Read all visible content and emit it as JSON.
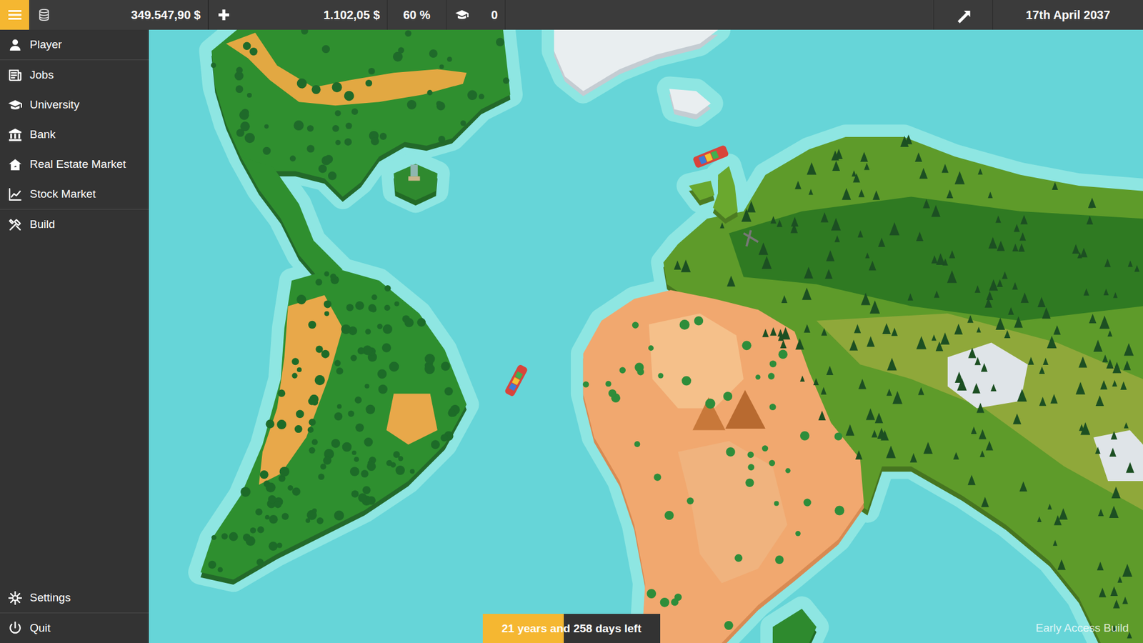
{
  "topbar": {
    "money": "349.547,90 $",
    "income": "1.102,05 $",
    "percent": "60 %",
    "education": "0",
    "date": "17th April 2037"
  },
  "sidebar": {
    "groups": [
      {
        "items": [
          {
            "label": "Player"
          }
        ]
      },
      {
        "items": [
          {
            "label": "Jobs"
          },
          {
            "label": "University"
          },
          {
            "label": "Bank"
          },
          {
            "label": "Real Estate Market"
          },
          {
            "label": "Stock Market"
          }
        ]
      },
      {
        "items": [
          {
            "label": "Build"
          }
        ]
      }
    ],
    "bottom_groups": [
      {
        "items": [
          {
            "label": "Settings"
          }
        ]
      },
      {
        "items": [
          {
            "label": "Quit"
          }
        ]
      }
    ]
  },
  "countdown": {
    "label": "21 years and 258 days left",
    "level": 0.455
  },
  "watermark": "Early Access Build"
}
